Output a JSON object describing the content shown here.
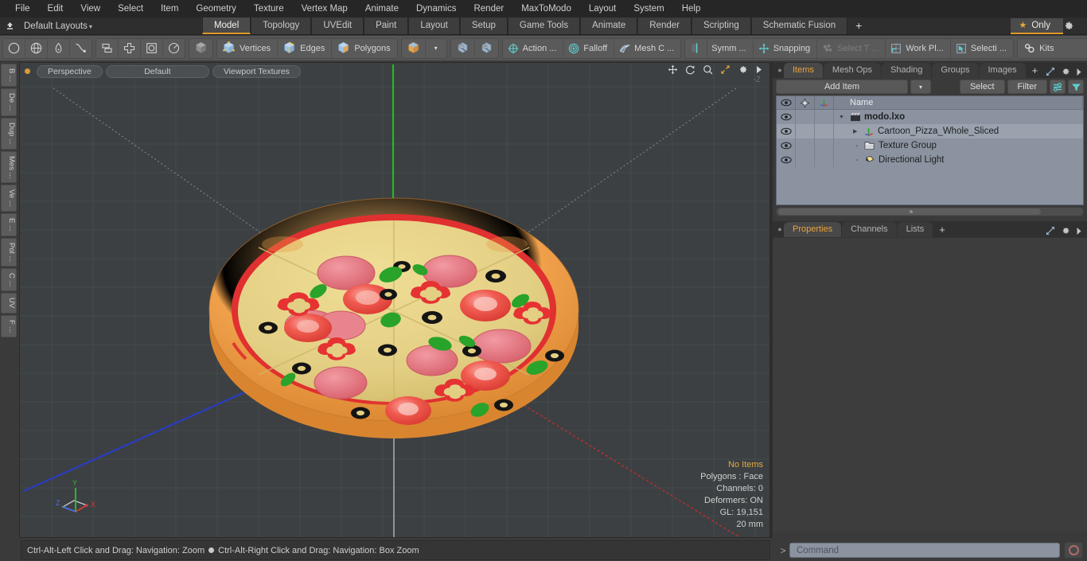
{
  "app": {
    "title": "modo"
  },
  "menubar": {
    "items": [
      "File",
      "Edit",
      "View",
      "Select",
      "Item",
      "Geometry",
      "Texture",
      "Vertex Map",
      "Animate",
      "Dynamics",
      "Render",
      "MaxToModo",
      "Layout",
      "System",
      "Help"
    ]
  },
  "layoutbar": {
    "home_icon": "home-up-icon",
    "layout_label": "Default Layouts",
    "caret": "▾",
    "tabs": [
      {
        "label": "Model",
        "active": true
      },
      {
        "label": "Topology",
        "active": false
      },
      {
        "label": "UVEdit",
        "active": false
      },
      {
        "label": "Paint",
        "active": false
      },
      {
        "label": "Layout",
        "active": false
      },
      {
        "label": "Setup",
        "active": false
      },
      {
        "label": "Game Tools",
        "active": false
      },
      {
        "label": "Animate",
        "active": false
      },
      {
        "label": "Render",
        "active": false
      },
      {
        "label": "Scripting",
        "active": false
      },
      {
        "label": "Schematic Fusion",
        "active": false
      }
    ],
    "add_tab": "+",
    "only_label": "Only",
    "only_star": "★",
    "gear_icon": "gear-icon"
  },
  "toolbar": {
    "shape_tools": [
      "circle-icon",
      "globe-icon",
      "pen-icon",
      "curve-icon"
    ],
    "arrange_tools": [
      "align-icon",
      "center-icon",
      "bound-icon",
      "radial-icon"
    ],
    "selection_mode_icon": "cube-gray-icon",
    "component_modes": [
      {
        "label": "Vertices",
        "icon": "cube-vertices-icon"
      },
      {
        "label": "Edges",
        "icon": "cube-edges-icon"
      },
      {
        "label": "Polygons",
        "icon": "cube-polygons-icon"
      }
    ],
    "item_mode_icon": "cube-item-icon",
    "item_mode_caret": "▾",
    "snapshot_icons": [
      "sphere-snap-icon",
      "sphere-snap2-icon"
    ],
    "tools": [
      {
        "label": "Action  ...",
        "icon": "action-center-icon",
        "dim": false
      },
      {
        "label": "Falloff",
        "icon": "falloff-icon",
        "dim": false
      },
      {
        "label": "Mesh C ...",
        "icon": "mesh-constraint-icon",
        "dim": false
      },
      {
        "label": "Symm ...",
        "icon": "symmetry-icon",
        "dim": false
      },
      {
        "label": "Snapping",
        "icon": "snapping-icon",
        "dim": false
      },
      {
        "label": "Select T ...",
        "icon": "select-through-icon",
        "dim": true
      },
      {
        "label": "Work Pl...",
        "icon": "work-plane-icon",
        "dim": false
      },
      {
        "label": "Selecti ...",
        "icon": "selection-set-icon",
        "dim": false
      }
    ],
    "kits_label": "Kits",
    "kits_icon": "gears-icon",
    "unity_icon": "unity-cube-icon",
    "unreal_icon": "unreal-icon"
  },
  "left_tabs": {
    "items": [
      "B ...",
      "De ...",
      "Dup ...",
      "Mes ...",
      "Ve ...",
      "E ...",
      "Pol ...",
      "C ...",
      "UV",
      "F ..."
    ]
  },
  "viewport": {
    "dot_color": "#d79a33",
    "view_pill": "Perspective",
    "shading_pill": "Default",
    "texture_pill": "Viewport Textures",
    "nav_icons": [
      "move-icon",
      "rotate-icon",
      "zoom-icon",
      "fit-icon",
      "gear-icon",
      "play-icon"
    ],
    "z_label": "-Z",
    "stats": {
      "items_label": "No Items",
      "polygons": "Polygons : Face",
      "channels": "Channels: 0",
      "deformers": "Deformers: ON",
      "gl": "GL: 19,151",
      "scale": "20 mm"
    },
    "axis_gizmo": {
      "x": "X",
      "y": "Y",
      "z": "Z"
    },
    "background_color": "#3c4043",
    "grid_color": "#4a4f52",
    "x_axis_color": "#b03030",
    "y_axis_color": "#22bb22",
    "z_axis_color": "#2a3cc0",
    "model_name": "Cartoon Pizza Whole Sliced",
    "model_colors": {
      "crust": "#f0a04b",
      "crust_shadow": "#d88a3c",
      "cheese": "#e8d58a",
      "sauce": "#e03030",
      "salami": "#e8737d",
      "salami_dark": "#d45a66",
      "tomato": "#f04848",
      "olive": "#1a1a1a",
      "basil": "#29a329",
      "pepper": "#e63232"
    }
  },
  "right_panel": {
    "tabs": [
      {
        "label": "Items",
        "active": true
      },
      {
        "label": "Mesh Ops",
        "active": false
      },
      {
        "label": "Shading",
        "active": false
      },
      {
        "label": "Groups",
        "active": false
      },
      {
        "label": "Images",
        "active": false
      }
    ],
    "add_tab": "+",
    "expand_icon": "expand-icon",
    "gear_icon": "gear-icon",
    "arrow_icon": "chevron-right-icon",
    "add_item_label": "Add Item",
    "add_item_caret": "▾",
    "select_label": "Select",
    "filter_label": "Filter",
    "list_icon": "list-options-icon",
    "funnel_icon": "funnel-icon",
    "tree_columns": {
      "visibility_icon": "eye-icon",
      "lock_icon": "pin-icon",
      "transform_icon": "axis-icon",
      "name_header": "Name"
    },
    "tree_rows": [
      {
        "name": "modo.lxo",
        "icon": "scene-icon",
        "depth": 0,
        "expanded": true,
        "root": true,
        "selected": false,
        "eye": "eye-icon"
      },
      {
        "name": "Cartoon_Pizza_Whole_Sliced",
        "icon": "mesh-axis-icon",
        "depth": 1,
        "expanded": false,
        "root": false,
        "selected": true,
        "eye": "eye-icon"
      },
      {
        "name": "Texture Group",
        "icon": "folder-icon",
        "depth": 1,
        "expanded": null,
        "root": false,
        "selected": false,
        "eye": "eye-icon"
      },
      {
        "name": "Directional Light",
        "icon": "light-icon",
        "depth": 1,
        "expanded": null,
        "root": false,
        "selected": false,
        "eye": "eye-icon"
      }
    ]
  },
  "properties_panel": {
    "tabs": [
      {
        "label": "Properties",
        "active": true
      },
      {
        "label": "Channels",
        "active": false
      },
      {
        "label": "Lists",
        "active": false
      }
    ],
    "add_tab": "+",
    "expand_icon": "expand-icon",
    "gear_icon": "gear-icon",
    "arrow_icon": "chevron-right-icon"
  },
  "statusbar": {
    "hint_left": "Ctrl-Alt-Left Click and Drag: Navigation: Zoom",
    "hint_right": "Ctrl-Alt-Right Click and Drag: Navigation: Box Zoom"
  },
  "command_bar": {
    "prompt": "&gt;",
    "placeholder": "Command",
    "record_icon": "record-icon"
  }
}
